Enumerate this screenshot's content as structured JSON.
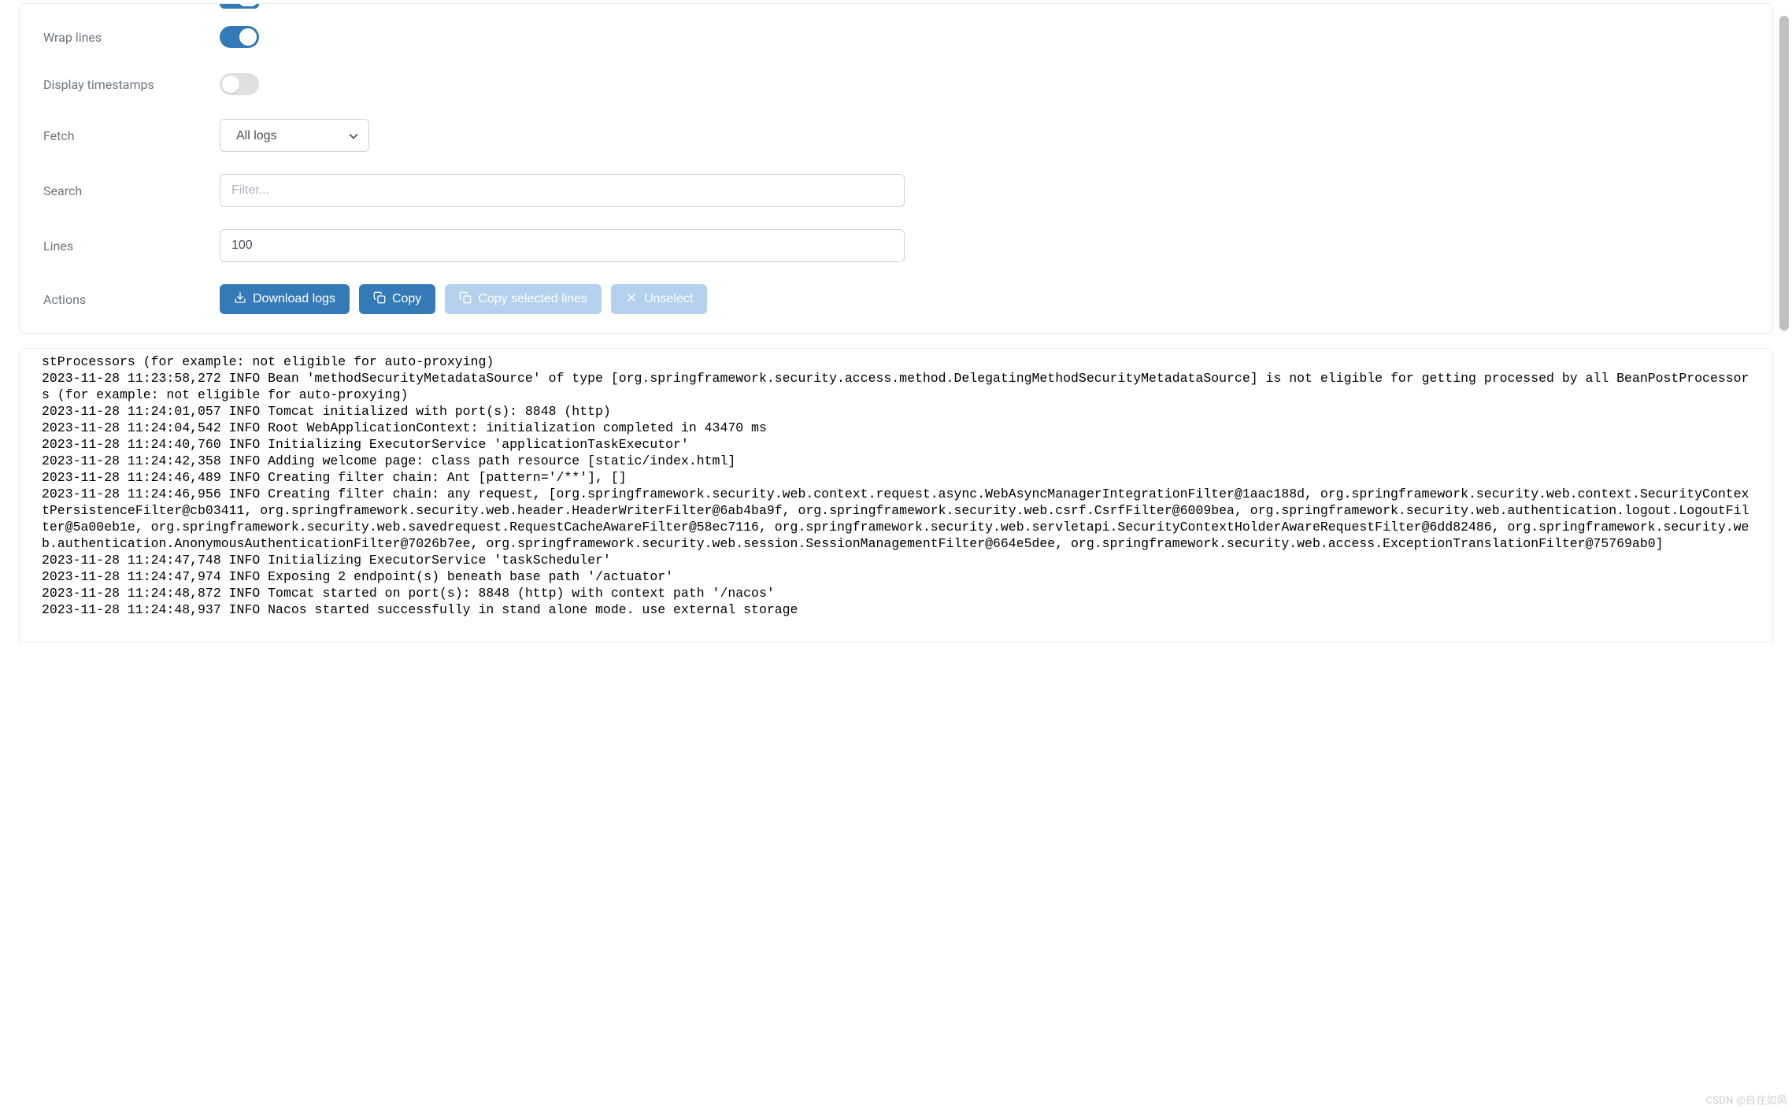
{
  "settings": {
    "wrap_lines": {
      "label": "Wrap lines",
      "value": true
    },
    "display_timestamps": {
      "label": "Display timestamps",
      "value": false
    },
    "fetch": {
      "label": "Fetch",
      "selected": "All logs"
    },
    "search": {
      "label": "Search",
      "value": "",
      "placeholder": "Filter..."
    },
    "lines": {
      "label": "Lines",
      "value": "100"
    },
    "actions": {
      "label": "Actions",
      "download": "Download logs",
      "copy": "Copy",
      "copy_selected": "Copy selected lines",
      "unselect": "Unselect"
    }
  },
  "logs_text": "stProcessors (for example: not eligible for auto-proxying)\n2023-11-28 11:23:58,272 INFO Bean 'methodSecurityMetadataSource' of type [org.springframework.security.access.method.DelegatingMethodSecurityMetadataSource] is not eligible for getting processed by all BeanPostProcessors (for example: not eligible for auto-proxying)\n2023-11-28 11:24:01,057 INFO Tomcat initialized with port(s): 8848 (http)\n2023-11-28 11:24:04,542 INFO Root WebApplicationContext: initialization completed in 43470 ms\n2023-11-28 11:24:40,760 INFO Initializing ExecutorService 'applicationTaskExecutor'\n2023-11-28 11:24:42,358 INFO Adding welcome page: class path resource [static/index.html]\n2023-11-28 11:24:46,489 INFO Creating filter chain: Ant [pattern='/**'], []\n2023-11-28 11:24:46,956 INFO Creating filter chain: any request, [org.springframework.security.web.context.request.async.WebAsyncManagerIntegrationFilter@1aac188d, org.springframework.security.web.context.SecurityContextPersistenceFilter@cb03411, org.springframework.security.web.header.HeaderWriterFilter@6ab4ba9f, org.springframework.security.web.csrf.CsrfFilter@6009bea, org.springframework.security.web.authentication.logout.LogoutFilter@5a00eb1e, org.springframework.security.web.savedrequest.RequestCacheAwareFilter@58ec7116, org.springframework.security.web.servletapi.SecurityContextHolderAwareRequestFilter@6dd82486, org.springframework.security.web.authentication.AnonymousAuthenticationFilter@7026b7ee, org.springframework.security.web.session.SessionManagementFilter@664e5dee, org.springframework.security.web.access.ExceptionTranslationFilter@75769ab0]\n2023-11-28 11:24:47,748 INFO Initializing ExecutorService 'taskScheduler'\n2023-11-28 11:24:47,974 INFO Exposing 2 endpoint(s) beneath base path '/actuator'\n2023-11-28 11:24:48,872 INFO Tomcat started on port(s): 8848 (http) with context path '/nacos'\n2023-11-28 11:24:48,937 INFO Nacos started successfully in stand alone mode. use external storage",
  "watermark": "CSDN @自在如风"
}
